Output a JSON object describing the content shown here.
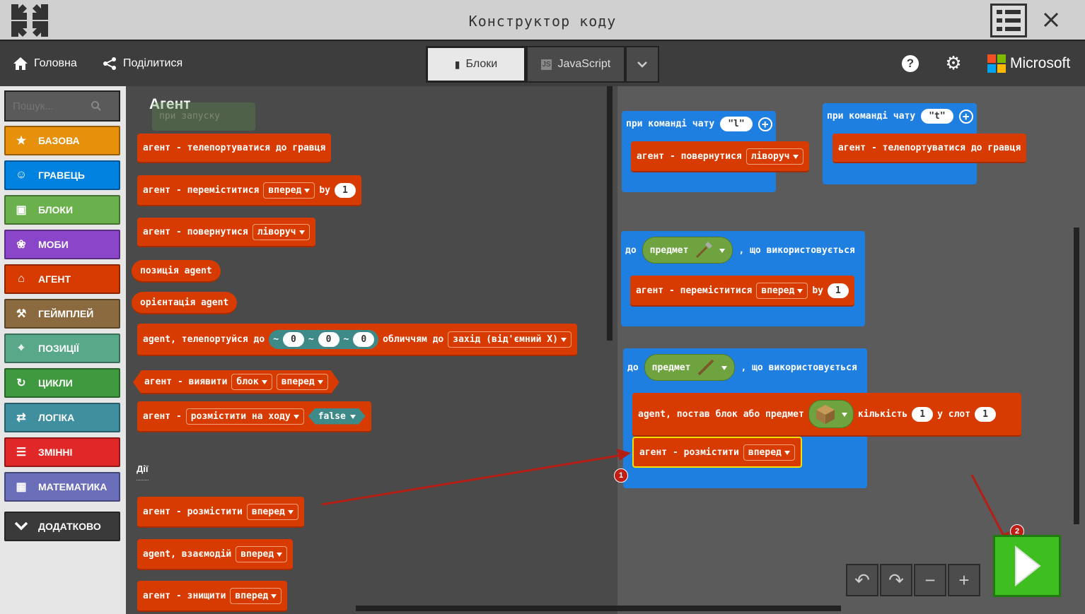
{
  "window": {
    "title": "Конструктор коду"
  },
  "menu": {
    "home": "Головна",
    "share": "Поділитися",
    "tab_blocks": "Блоки",
    "tab_js": "JavaScript",
    "brand": "Microsoft"
  },
  "search": {
    "placeholder": "Пошук..."
  },
  "categories": [
    {
      "label": "БАЗОВА",
      "color": "#e6900b",
      "icon": "star-icon"
    },
    {
      "label": "ГРАВЕЦЬ",
      "color": "#0083e0",
      "icon": "person-icon"
    },
    {
      "label": "БЛОКИ",
      "color": "#6ab04c",
      "icon": "cube-icon"
    },
    {
      "label": "МОБИ",
      "color": "#8a45c9",
      "icon": "paw-icon"
    },
    {
      "label": "АГЕНТ",
      "color": "#d83b01",
      "icon": "agent-icon"
    },
    {
      "label": "ГЕЙМПЛЕЙ",
      "color": "#8c6a3f",
      "icon": "wrench-icon"
    },
    {
      "label": "ПОЗИЦІЇ",
      "color": "#5aa88a",
      "icon": "crosshair-icon"
    },
    {
      "label": "ЦИКЛИ",
      "color": "#3f9a3f",
      "icon": "loop-icon"
    },
    {
      "label": "ЛОГІКА",
      "color": "#3f8f9e",
      "icon": "shuffle-icon"
    },
    {
      "label": "ЗМІННІ",
      "color": "#e02828",
      "icon": "list-icon"
    },
    {
      "label": "МАТЕМАТИКА",
      "color": "#6b6eb8",
      "icon": "calculator-icon"
    }
  ],
  "more": {
    "label": "ДОДАТКОВО"
  },
  "flyout": {
    "title": "Агент",
    "ghost": "при запуску",
    "section_actions": "Дії",
    "blocks": {
      "teleport": "агент - телепортуватися до гравця",
      "move": "агент - переміститися",
      "move_dir": "вперед",
      "by": "by",
      "move_n": "1",
      "turn": "агент - повернутися",
      "turn_dir": "ліворуч",
      "position": "позиція agent",
      "orientation": "орієнтація agent",
      "tp_to": "agent, телепортуйся до",
      "tilde": "~",
      "zero": "0",
      "facing": "обличчям до",
      "facing_dir": "захід (від'ємний X)",
      "detect": "агент - виявити",
      "detect_what": "блок",
      "detect_dir": "вперед",
      "place_move": "агент -",
      "place_move_opt": "розмістити на ходу",
      "false_val": "false",
      "place": "агент - розмістити",
      "place_dir": "вперед",
      "interact": "agent, взаємодій",
      "interact_dir": "вперед",
      "destroy": "агент - знищити",
      "destroy_dir": "вперед"
    }
  },
  "workspace": {
    "ev1": {
      "label": "при команді чату",
      "arg": "\"l\"",
      "body": "агент - повернутися",
      "body_dir": "ліворуч"
    },
    "ev2": {
      "label": "при команді чату",
      "arg": "\"t\"",
      "body": "агент - телепортуватися до гравця"
    },
    "ev3": {
      "pre": "до",
      "item": "предмет",
      "post": ", що використовується",
      "body": "агент - переміститися",
      "body_dir": "вперед",
      "by": "by",
      "n": "1"
    },
    "ev4": {
      "pre": "до",
      "item": "предмет",
      "post": ", що використовується",
      "b1": "agent, постав блок або предмет",
      "b1_count": "кількість",
      "b1_n": "1",
      "b1_slot": "у слот",
      "b1_slot_n": "1",
      "b2": "агент - розмістити",
      "b2_dir": "вперед"
    }
  },
  "annotations": {
    "badge1": "1",
    "badge2": "2"
  }
}
